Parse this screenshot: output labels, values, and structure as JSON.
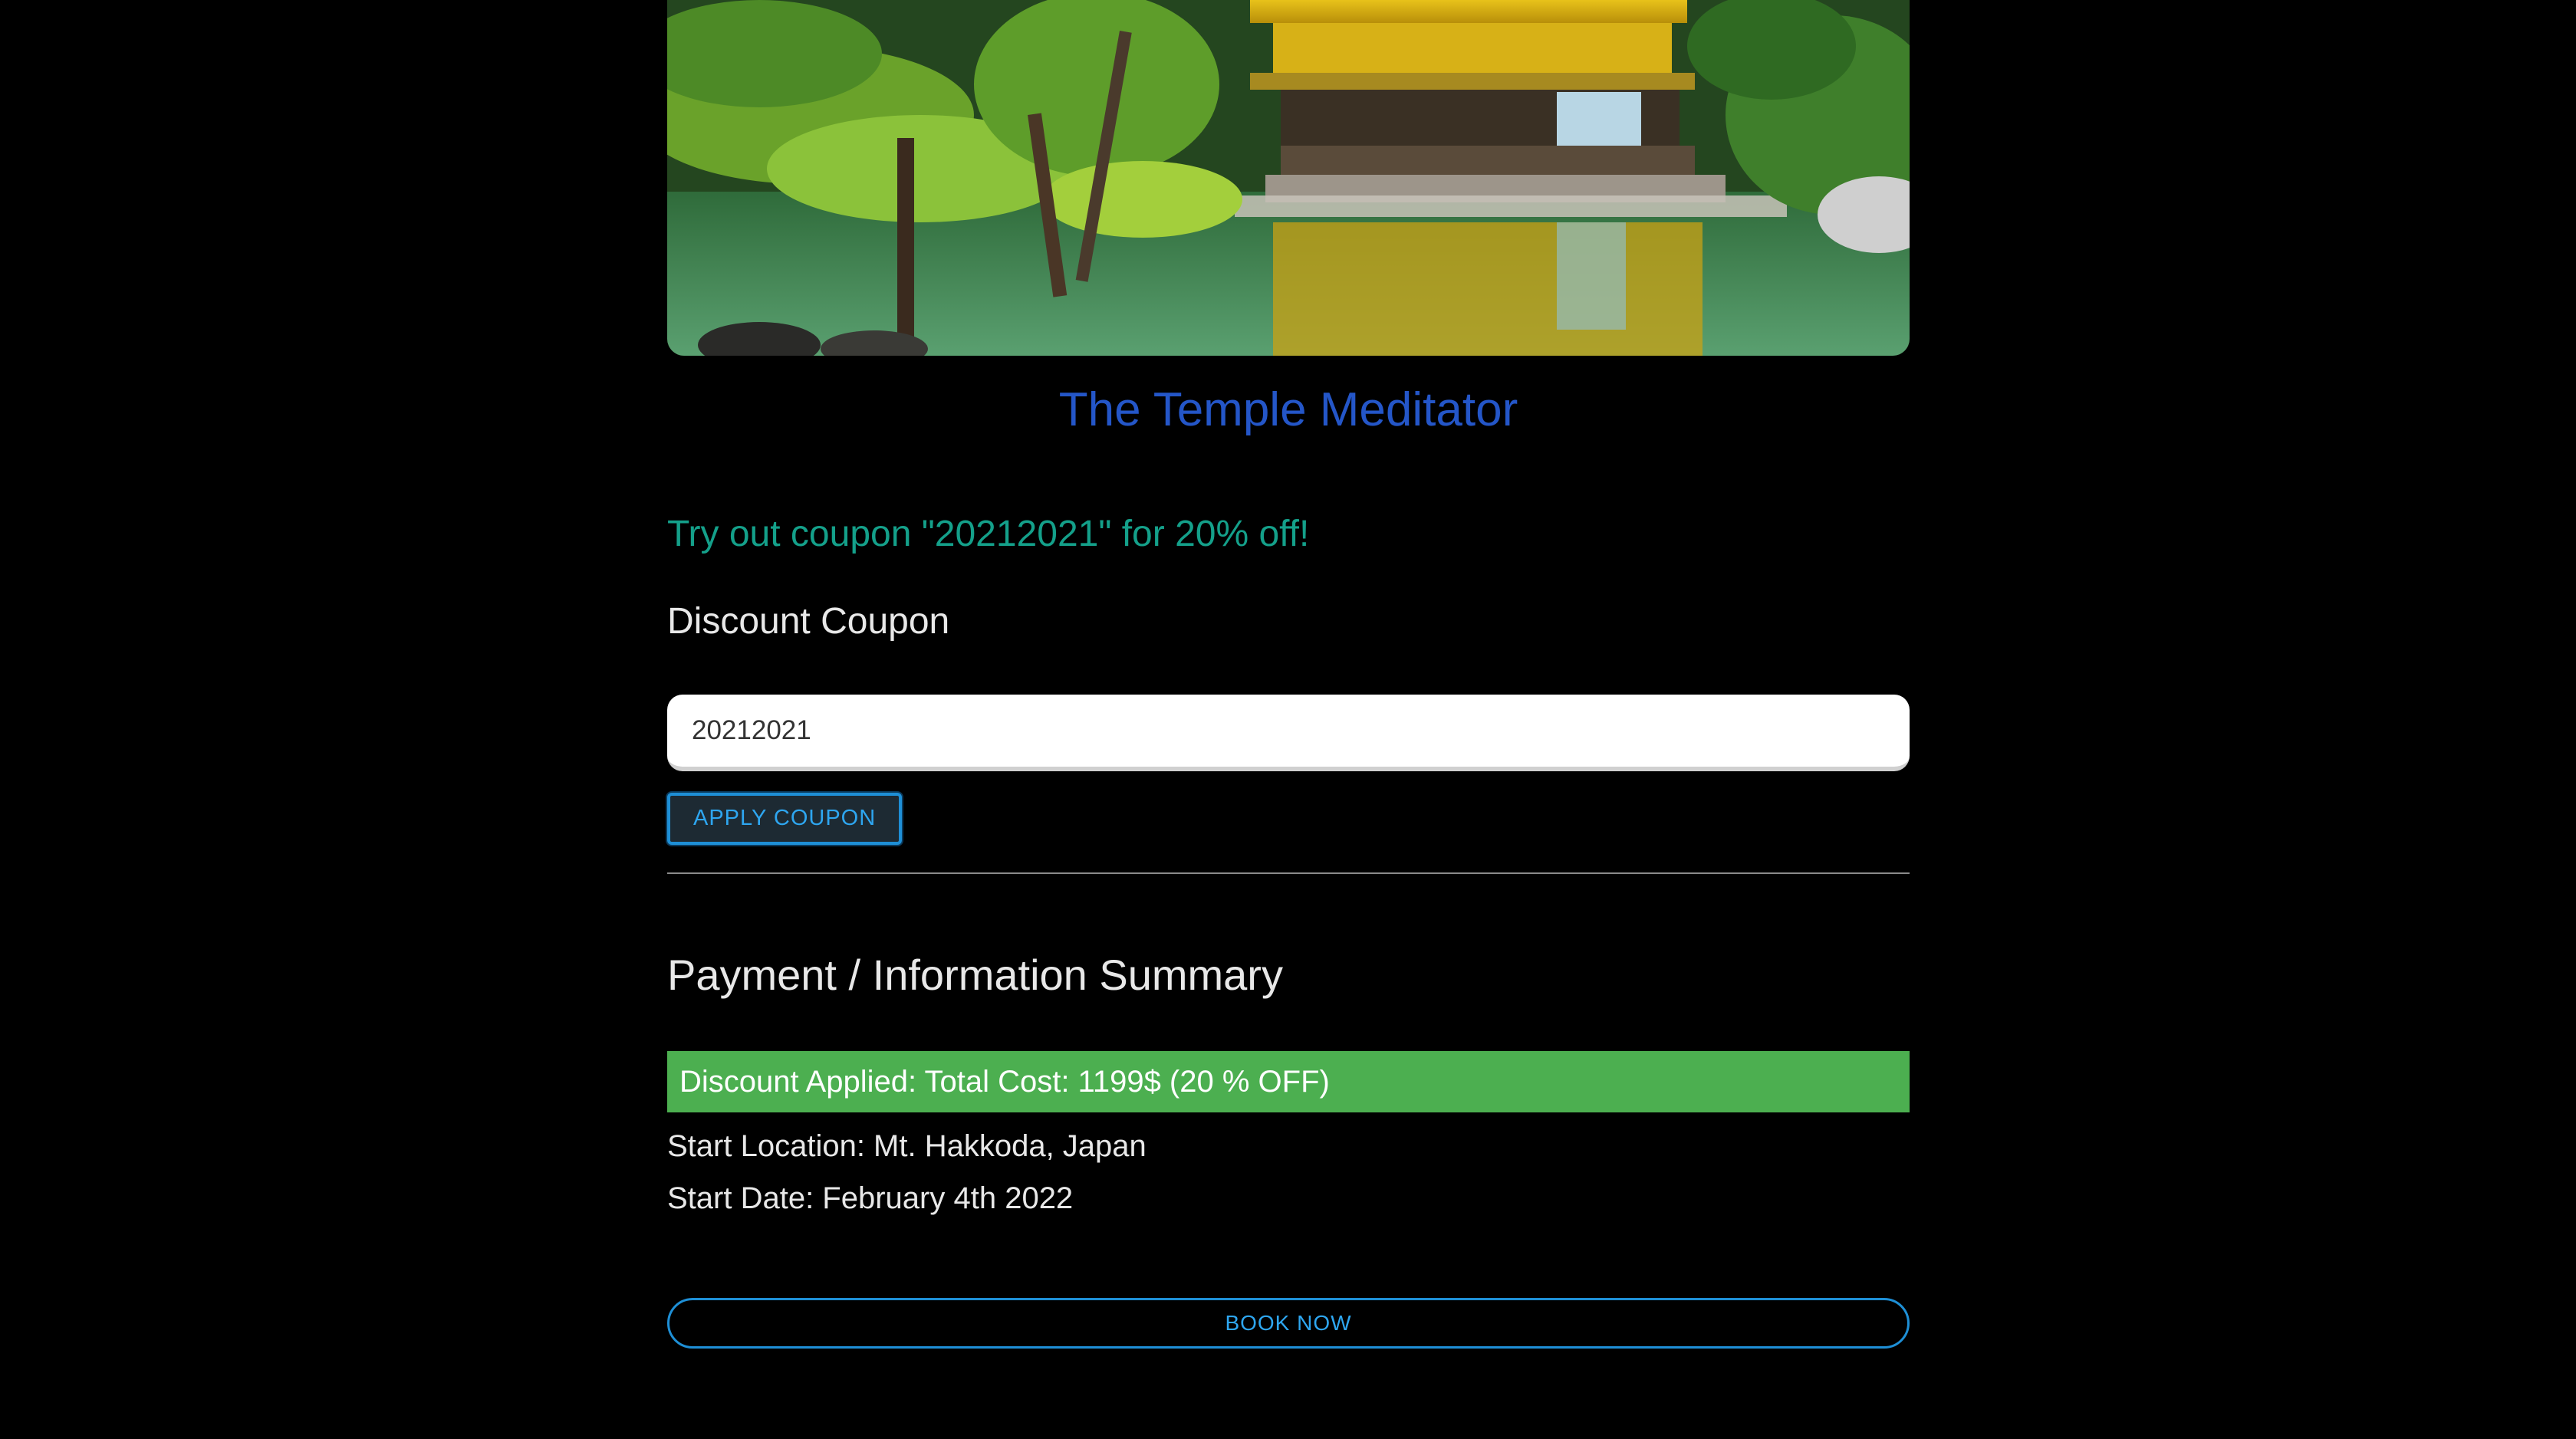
{
  "hero": {
    "image_description": "golden-pavilion-temple-image"
  },
  "experience": {
    "title": "The Temple Meditator"
  },
  "promo": {
    "text": "Try out coupon \"20212021\" for 20% off!"
  },
  "coupon": {
    "label": "Discount Coupon",
    "value": "20212021",
    "apply_label": "APPLY COUPON"
  },
  "summary": {
    "title": "Payment / Information Summary",
    "discount_text": "Discount Applied: Total Cost: 1199$ (20 % OFF)",
    "start_location": "Start Location: Mt. Hakkoda, Japan",
    "start_date": "Start Date: February 4th 2022",
    "book_label": "BOOK NOW"
  },
  "colors": {
    "background": "#000000",
    "title": "#2456c8",
    "promo": "#14a08a",
    "discount_bar": "#4caf50",
    "button_accent": "#1e8fd6"
  }
}
